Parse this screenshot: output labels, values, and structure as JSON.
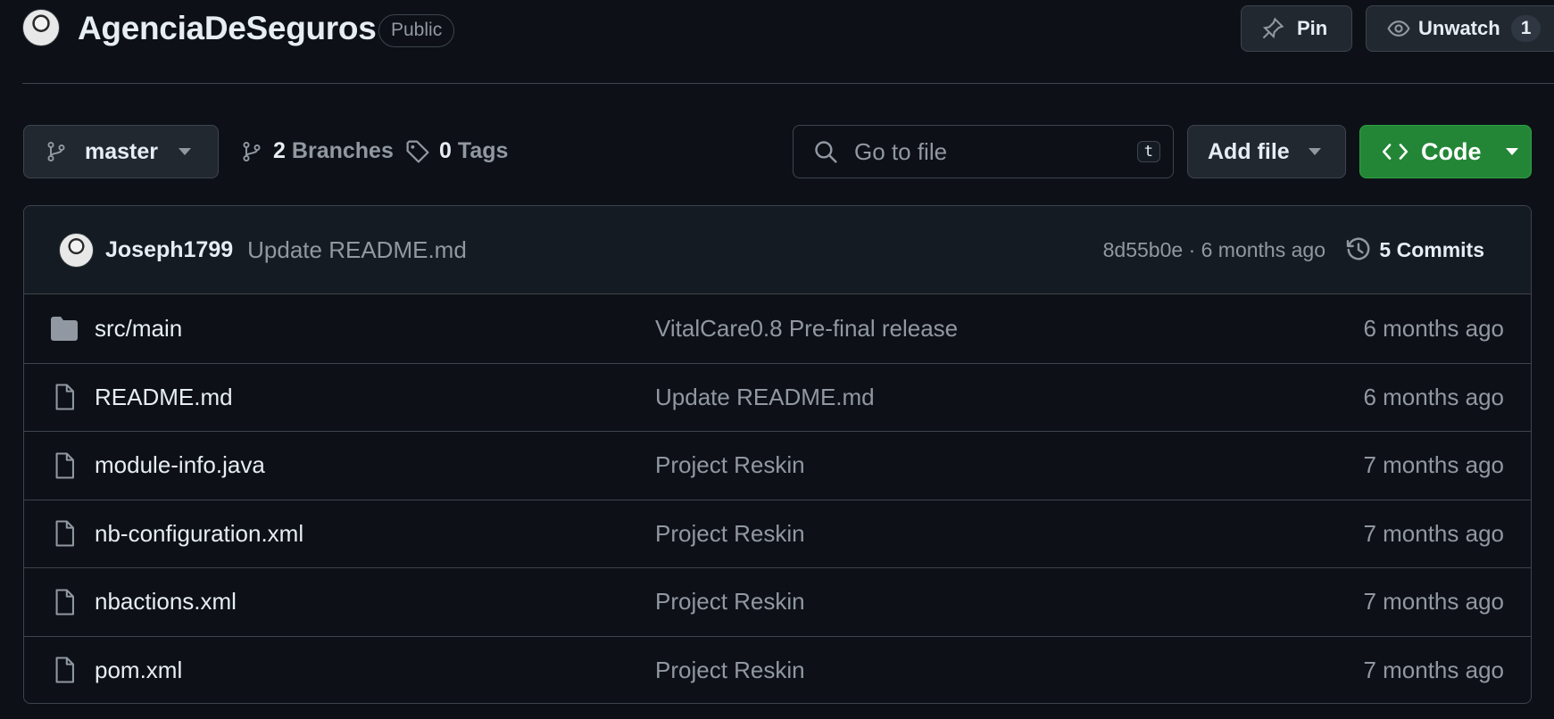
{
  "repo": {
    "name": "AgenciaDeSeguros",
    "visibility": "Public"
  },
  "actions": {
    "pin_label": "Pin",
    "watch_label": "Unwatch",
    "watch_count": "1"
  },
  "toolbar": {
    "branch": "master",
    "branches_count": "2",
    "branches_label": "Branches",
    "tags_count": "0",
    "tags_label": "Tags",
    "search_placeholder": "Go to file",
    "search_shortcut": "t",
    "add_file_label": "Add file",
    "code_label": "Code"
  },
  "latest_commit": {
    "author": "Joseph1799",
    "message": "Update README.md",
    "hash_time": "8d55b0e · 6 months ago",
    "commits_label": "5 Commits"
  },
  "files": [
    {
      "name": "src/main",
      "type": "folder",
      "message": "VitalCare0.8 Pre-final release",
      "age": "6 months ago"
    },
    {
      "name": "README.md",
      "type": "file",
      "message": "Update README.md",
      "age": "6 months ago"
    },
    {
      "name": "module-info.java",
      "type": "file",
      "message": "Project Reskin",
      "age": "7 months ago"
    },
    {
      "name": "nb-configuration.xml",
      "type": "file",
      "message": "Project Reskin",
      "age": "7 months ago"
    },
    {
      "name": "nbactions.xml",
      "type": "file",
      "message": "Project Reskin",
      "age": "7 months ago"
    },
    {
      "name": "pom.xml",
      "type": "file",
      "message": "Project Reskin",
      "age": "7 months ago"
    }
  ],
  "colors": {
    "background": "#0d1117",
    "code_button": "#238636",
    "muted_text": "#9198a1",
    "border": "#3d444d"
  }
}
